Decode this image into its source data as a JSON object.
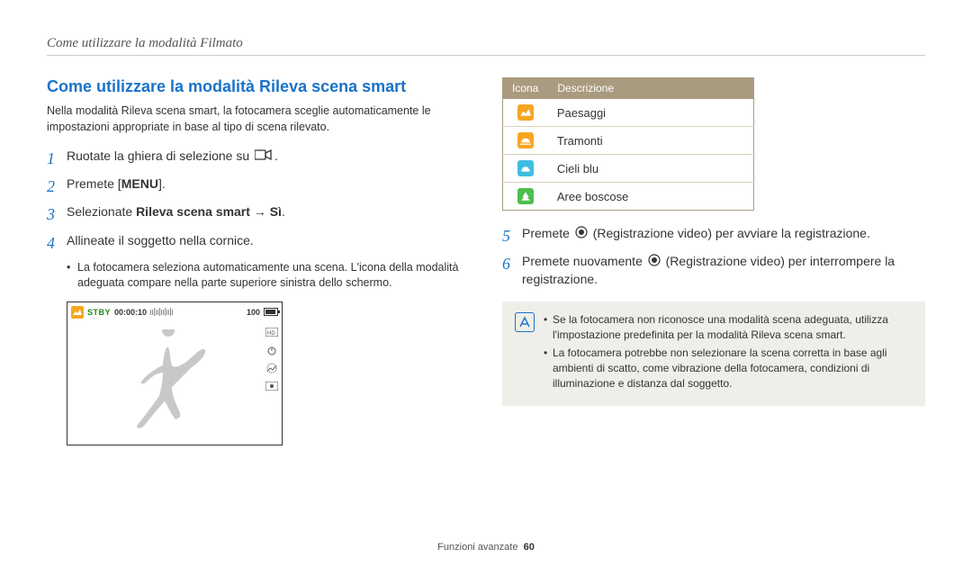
{
  "header": {
    "breadcrumb": "Come utilizzare la modalità Filmato"
  },
  "section_title": "Come utilizzare la modalità Rileva scena smart",
  "intro": "Nella modalità Rileva scena smart, la fotocamera sceglie automaticamente le impostazioni appropriate in base al tipo di scena rilevato.",
  "steps": {
    "s1": {
      "num": "1",
      "text": "Ruotate la ghiera di selezione su "
    },
    "s2": {
      "num": "2",
      "text_prefix": "Premete [",
      "menu_label": "MENU",
      "text_suffix": "]."
    },
    "s3": {
      "num": "3",
      "text_prefix": "Selezionate ",
      "bold1": "Rileva scena smart",
      "arrow": " → ",
      "bold2": "Sì",
      "text_suffix": "."
    },
    "s4": {
      "num": "4",
      "text": "Allineate il soggetto nella cornice.",
      "sub": "La fotocamera seleziona automaticamente una scena. L'icona della modalità adeguata compare nella parte superiore sinistra dello schermo."
    },
    "s5": {
      "num": "5",
      "text_prefix": "Premete ",
      "text_suffix": " (Registrazione video) per avviare la registrazione."
    },
    "s6": {
      "num": "6",
      "text_prefix": "Premete nuovamente ",
      "text_suffix": " (Registrazione video) per interrompere la registrazione."
    }
  },
  "screenshot": {
    "stby": "STBY",
    "time": "00:00:10",
    "hundred": "100"
  },
  "table": {
    "head_icon": "Icona",
    "head_desc": "Descrizione",
    "rows": [
      {
        "color": "#f5a623",
        "name": "landscape-icon",
        "desc": "Paesaggi"
      },
      {
        "color": "#f5a623",
        "name": "sunset-icon",
        "desc": "Tramonti"
      },
      {
        "color": "#3fbde0",
        "name": "sky-icon",
        "desc": "Cieli blu"
      },
      {
        "color": "#4dbf4d",
        "name": "forest-icon",
        "desc": "Aree boscose"
      }
    ]
  },
  "notes": {
    "n1": "Se la fotocamera non riconosce una modalità scena adeguata, utilizza l'impostazione predefinita per la modalità Rileva scena smart.",
    "n2": "La fotocamera potrebbe non selezionare la scena corretta in base agli ambienti di scatto, come vibrazione della fotocamera, condizioni di illuminazione e distanza dal soggetto."
  },
  "footer": {
    "section": "Funzioni avanzate",
    "page": "60"
  }
}
